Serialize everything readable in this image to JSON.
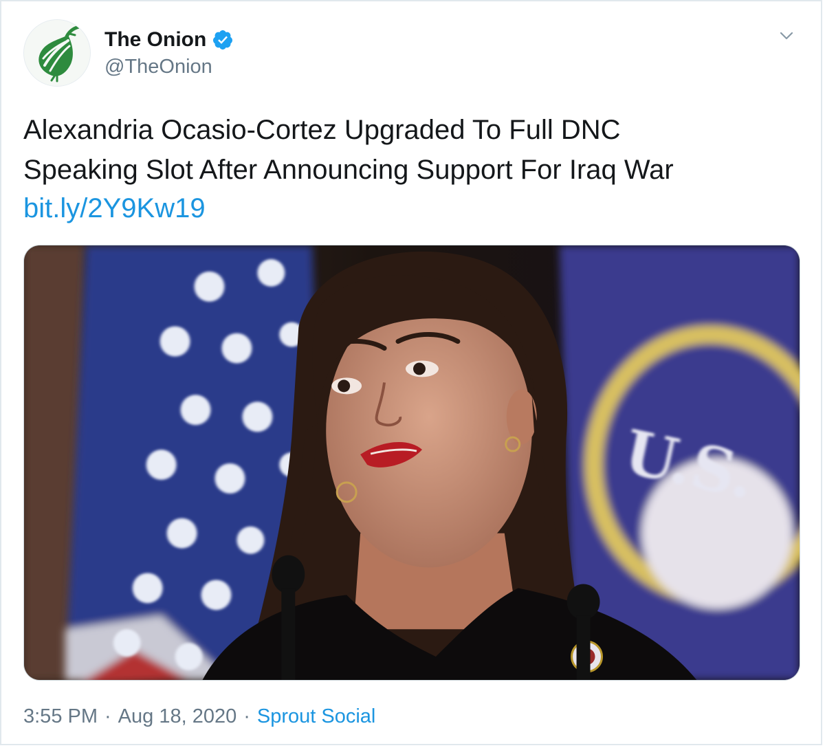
{
  "author": {
    "name": "The Onion",
    "handle": "@TheOnion"
  },
  "tweet": {
    "text_lines": [
      "Alexandria Ocasio-Cortez Upgraded To Full DNC",
      "Speaking Slot After Announcing Support For Iraq War"
    ],
    "link": "bit.ly/2Y9Kw19"
  },
  "meta": {
    "time": "3:55 PM",
    "separator": "·",
    "date": "Aug 18, 2020",
    "source": "Sprout Social"
  },
  "colors": {
    "link": "#1b95e0",
    "secondary_text": "#657786",
    "primary_text": "#14171a",
    "verified": "#1da1f2",
    "onion_green": "#2e8b3e"
  },
  "icons": {
    "avatar": "onion-logo-icon",
    "verified": "verified-badge-icon",
    "menu": "chevron-down-icon"
  }
}
